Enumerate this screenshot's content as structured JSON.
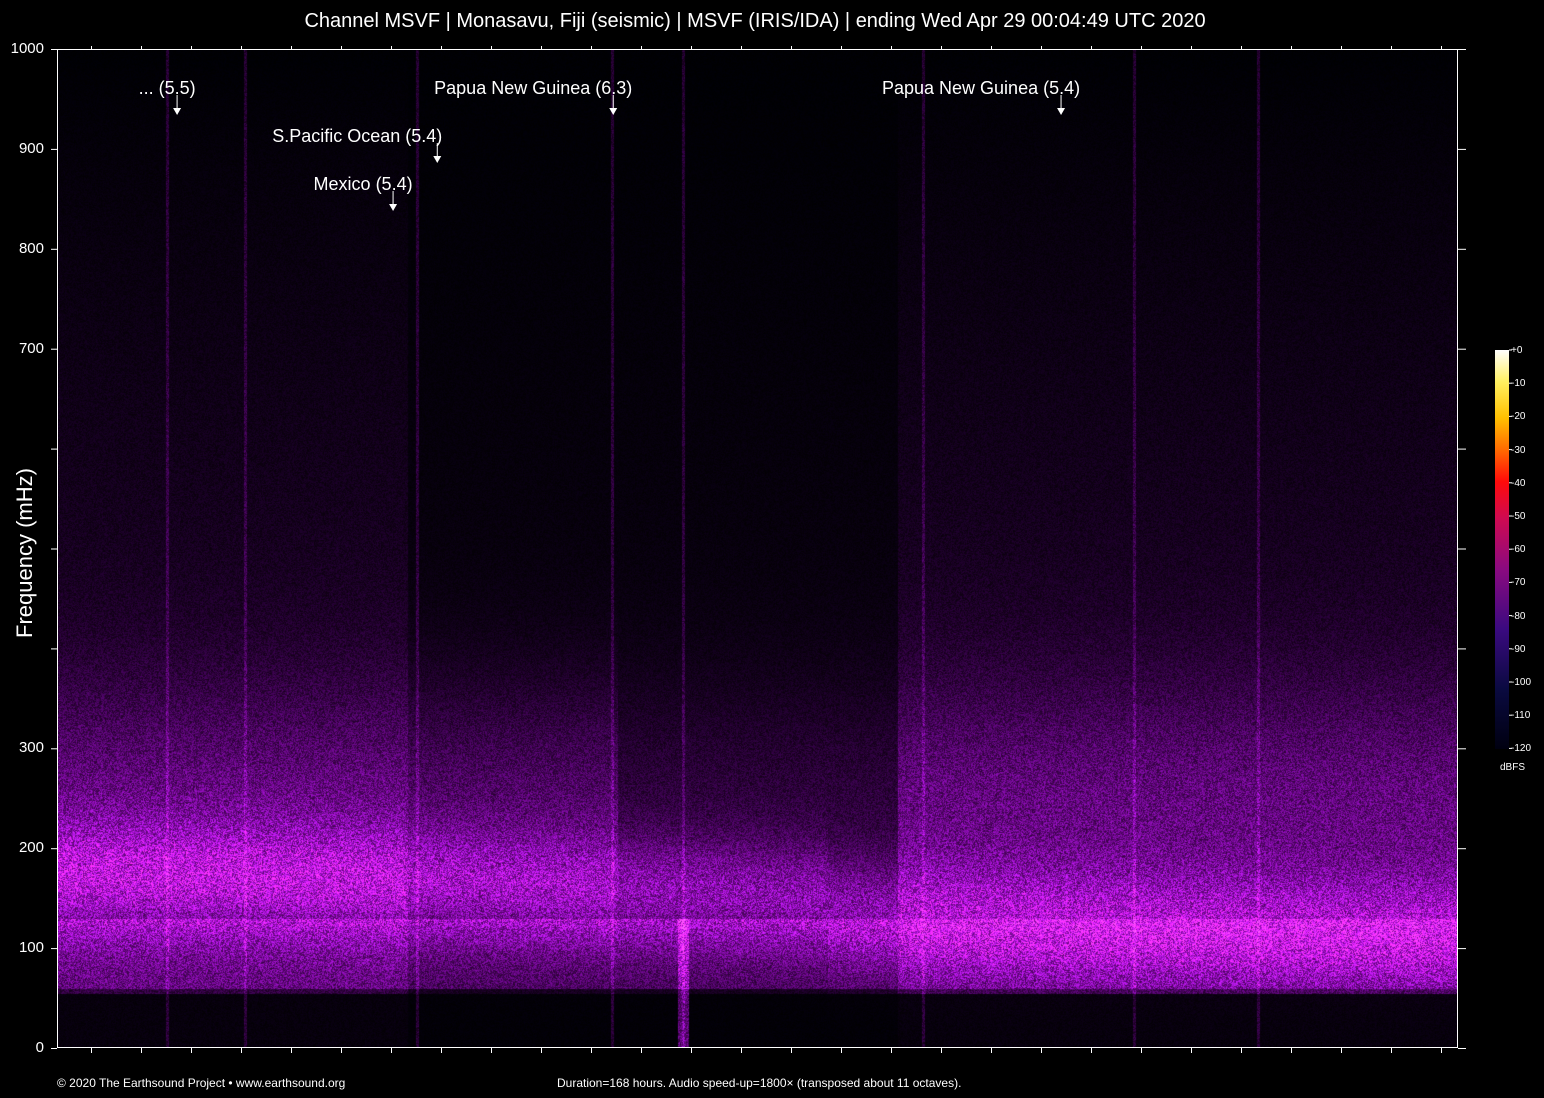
{
  "title": "Channel MSVF | Monasavu, Fiji (seismic) | MSVF (IRIS/IDA) | ending Wed Apr 29 00:04:49 UTC 2020",
  "chart_data": {
    "type": "heatmap",
    "title": "Channel MSVF | Monasavu, Fiji (seismic) | MSVF (IRIS/IDA) | ending Wed Apr 29 00:04:49 UTC 2020",
    "xlabel": "",
    "ylabel": "Frequency (mHz)",
    "ylim": [
      0,
      1000
    ],
    "xlim_hours": [
      0,
      168
    ],
    "ytick_labels": [
      "0",
      "100",
      "200",
      "300",
      "700",
      "800",
      "900",
      "1000"
    ],
    "ytick_values": [
      0,
      100,
      200,
      300,
      700,
      800,
      900,
      1000
    ],
    "colorbar": {
      "unit": "dBFS",
      "range": [
        -120,
        0
      ],
      "tick_labels": [
        "+0",
        "-10",
        "-20",
        "-30",
        "-40",
        "-50",
        "-60",
        "-70",
        "-80",
        "-90",
        "-100",
        "-110",
        "-120"
      ]
    },
    "annotations": [
      {
        "label": "... (5.5)",
        "hour": 14.4,
        "level": 0
      },
      {
        "label": "Papua New Guinea (6.3)",
        "hour": 66.7,
        "level": 0
      },
      {
        "label": "Papua New Guinea (5.4)",
        "hour": 120.4,
        "level": 0
      },
      {
        "label": "S.Pacific Ocean (5.4)",
        "hour": 45.6,
        "level": 1
      },
      {
        "label": "Mexico (5.4)",
        "hour": 40.3,
        "level": 2
      }
    ]
  },
  "footer": {
    "copyright": "© 2020 The Earthsound Project • www.earthsound.org",
    "info": "Duration=168 hours. Audio speed-up=1800× (transposed about 11 octaves)."
  }
}
